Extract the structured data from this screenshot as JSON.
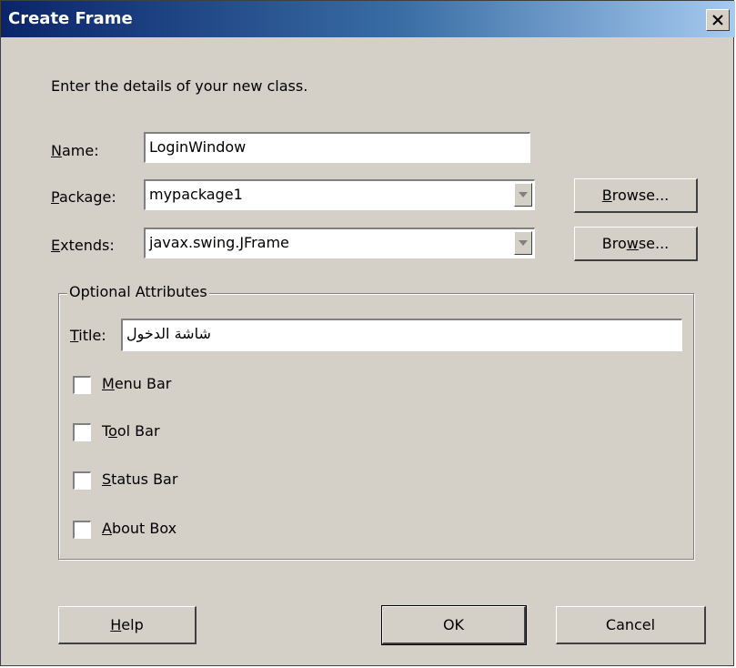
{
  "window": {
    "title": "Create Frame",
    "close_glyph": "✕"
  },
  "instructions": "Enter the details of your new class.",
  "name_field": {
    "label_mnemonic": "N",
    "label_rest": "ame:",
    "value": "LoginWindow"
  },
  "package_field": {
    "label_mnemonic": "P",
    "label_rest": "ackage:",
    "value": "mypackage1",
    "browse_pre": "",
    "browse_mnemonic": "B",
    "browse_post": "rowse..."
  },
  "extends_field": {
    "label_mnemonic": "E",
    "label_rest": "xtends:",
    "value": "javax.swing.JFrame",
    "browse_pre": "Bro",
    "browse_mnemonic": "w",
    "browse_post": "se..."
  },
  "optional": {
    "group_label": "Optional Attributes",
    "title_label_mnemonic": "T",
    "title_label_rest": "itle:",
    "title_value": "شاشة الدخول",
    "checkboxes": [
      {
        "pre": "",
        "mnemonic": "M",
        "post": "enu Bar",
        "checked": false
      },
      {
        "pre": "T",
        "mnemonic": "o",
        "post": "ol Bar",
        "checked": false
      },
      {
        "pre": "",
        "mnemonic": "S",
        "post": "tatus Bar",
        "checked": false
      },
      {
        "pre": "",
        "mnemonic": "A",
        "post": "bout Box",
        "checked": false
      }
    ]
  },
  "buttons": {
    "help_mnemonic": "H",
    "help_rest": "elp",
    "ok": "OK",
    "cancel": "Cancel"
  },
  "icons": {
    "close": "close-icon",
    "dropdown": "chevron-down-icon"
  }
}
